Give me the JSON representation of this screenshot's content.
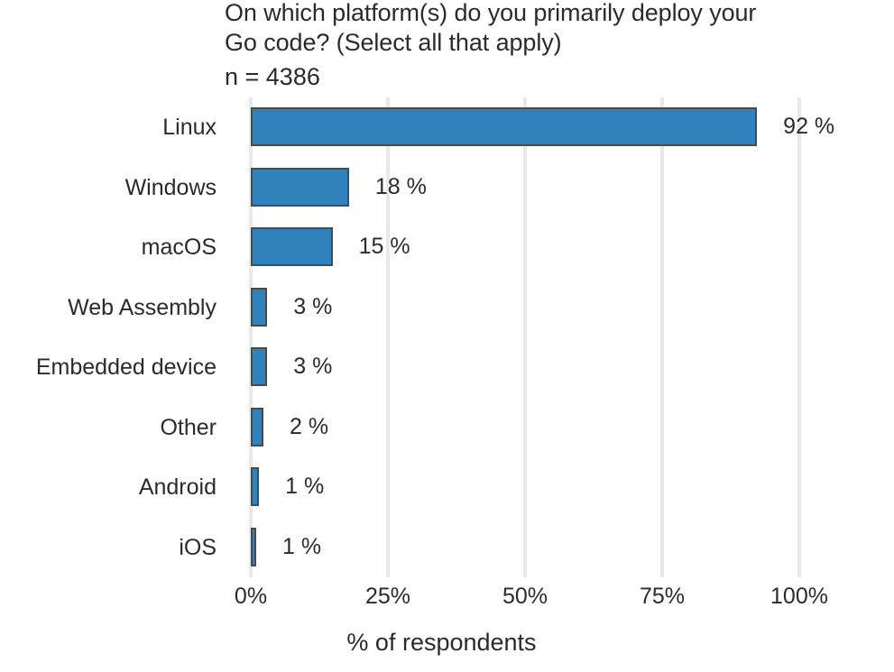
{
  "chart_data": {
    "type": "bar",
    "orientation": "horizontal",
    "title": "On which platform(s) do you primarily deploy your",
    "title_line2": "Go code? (Select all that apply)",
    "subtitle": "n =  4386",
    "xlabel": "% of respondents",
    "ylabel": "",
    "categories": [
      "Linux",
      "Windows",
      "macOS",
      "Web Assembly",
      "Embedded device",
      "Other",
      "Android",
      "iOS"
    ],
    "values": [
      92,
      18,
      15,
      3,
      3,
      2,
      1,
      1
    ],
    "bar_widths_pct": [
      92.3,
      17.9,
      14.9,
      3.0,
      3.0,
      2.3,
      1.5,
      0.9
    ],
    "data_labels": [
      "92 %",
      "18 %",
      "15 %",
      "3 %",
      "3 %",
      "2 %",
      "1 %",
      "1 %"
    ],
    "xlim": [
      0,
      100
    ],
    "xticks": [
      0,
      25,
      50,
      75,
      100
    ],
    "xticklabels": [
      "0%",
      "25%",
      "50%",
      "75%",
      "100%"
    ],
    "grid": "vertical-only",
    "legend": "none",
    "colors": {
      "bar_fill": "#3082bd",
      "bar_border": "#4a4a4a",
      "gridline": "#e9e9e9",
      "text": "#2b2b2b",
      "background": "#ffffff"
    }
  }
}
